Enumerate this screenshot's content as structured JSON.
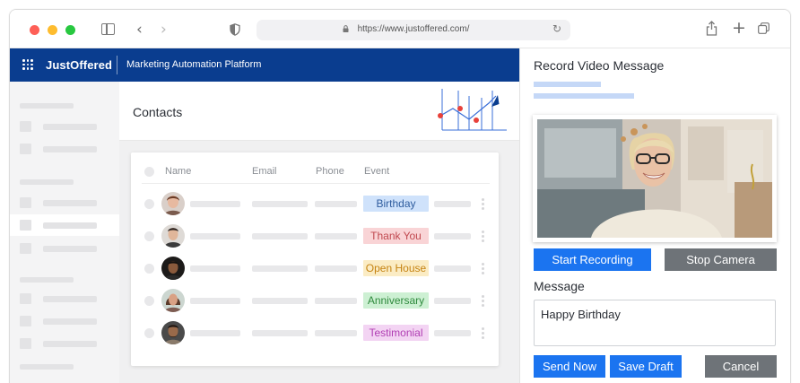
{
  "browser": {
    "url": "https://www.justoffered.com/"
  },
  "app": {
    "brand": "JustOffered",
    "subtitle": "Marketing Automation Platform"
  },
  "contacts": {
    "title": "Contacts",
    "columns": [
      "Name",
      "Email",
      "Phone",
      "Event"
    ],
    "rows": [
      {
        "event": "Birthday",
        "badge_bg": "#cfe2fb",
        "badge_fg": "#2e5c9e"
      },
      {
        "event": "Thank You",
        "badge_bg": "#f9d4d6",
        "badge_fg": "#c0484f"
      },
      {
        "event": "Open House",
        "badge_bg": "#fbecc4",
        "badge_fg": "#c58312"
      },
      {
        "event": "Anniversary",
        "badge_bg": "#cdf0d3",
        "badge_fg": "#2f8a3d"
      },
      {
        "event": "Testimonial",
        "badge_bg": "#f3d4f3",
        "badge_fg": "#b03db3"
      }
    ]
  },
  "panel": {
    "title": "Record Video Message",
    "start_label": "Start Recording",
    "stop_label": "Stop Camera",
    "message_label": "Message",
    "message_value": "Happy Birthday",
    "send_label": "Send Now",
    "draft_label": "Save Draft",
    "cancel_label": "Cancel"
  },
  "colors": {
    "header_bg": "#0a3d8f",
    "primary_button": "#1b74f0",
    "secondary_button": "#6e7378"
  }
}
